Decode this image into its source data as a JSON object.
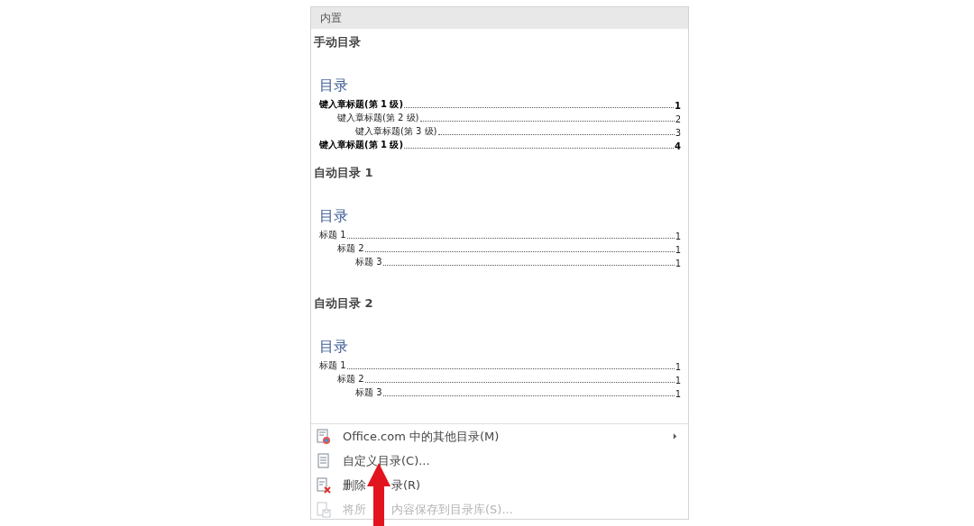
{
  "gallery": {
    "header": "内置",
    "entries": [
      {
        "title": "手动目录",
        "preview_heading": "目录",
        "lines": [
          {
            "text": "键入章标题(第 1 级)",
            "page": "1",
            "bold": true,
            "children": [
              {
                "text": "键入章标题(第 2 级)",
                "page": "2",
                "bold": false,
                "children": [
                  {
                    "text": "键入章标题(第 3 级)",
                    "page": "3",
                    "bold": false
                  }
                ]
              }
            ]
          },
          {
            "text": "键入章标题(第 1 级)",
            "page": "4",
            "bold": true
          }
        ]
      },
      {
        "title": "自动目录 1",
        "preview_heading": "目录",
        "lines": [
          {
            "text": "标题 1",
            "page": "1",
            "bold": false,
            "children": [
              {
                "text": "标题 2",
                "page": "1",
                "bold": false,
                "children": [
                  {
                    "text": "标题 3",
                    "page": "1",
                    "bold": false
                  }
                ]
              }
            ]
          }
        ]
      },
      {
        "title": "自动目录 2",
        "preview_heading": "目录",
        "lines": [
          {
            "text": "标题 1",
            "page": "1",
            "bold": false,
            "children": [
              {
                "text": "标题 2",
                "page": "1",
                "bold": false,
                "children": [
                  {
                    "text": "标题 3",
                    "page": "1",
                    "bold": false
                  }
                ]
              }
            ]
          }
        ]
      }
    ]
  },
  "menu": [
    {
      "label_parts": [
        "Office.com 中的其他目录(M)"
      ],
      "has_submenu": true,
      "disabled": false
    },
    {
      "label_parts": [
        "自定义目录(C)..."
      ],
      "has_submenu": false,
      "disabled": false
    },
    {
      "label_parts": [
        "删除",
        "录(R)"
      ],
      "has_submenu": false,
      "disabled": false
    },
    {
      "label_parts": [
        "将所",
        "内容保存到目录库(S)..."
      ],
      "has_submenu": false,
      "disabled": true
    }
  ]
}
